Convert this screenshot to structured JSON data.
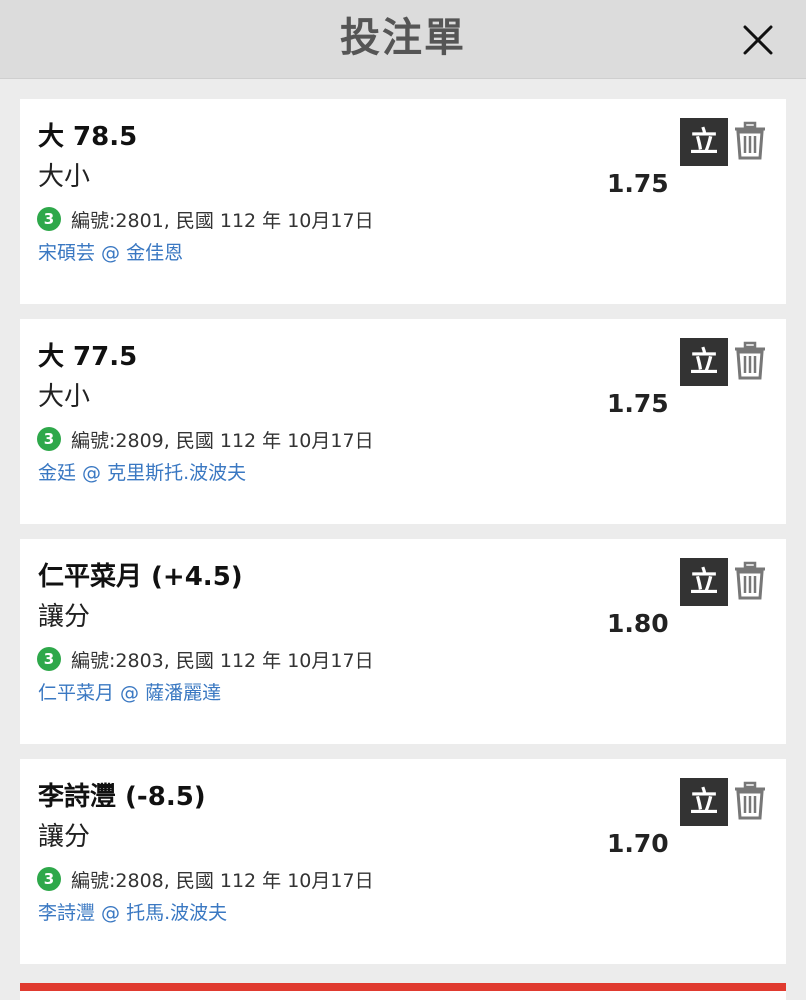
{
  "header": {
    "title": "投注單"
  },
  "bets": [
    {
      "selection": "大 78.5",
      "market": "大小",
      "odds": "1.75",
      "badge": "3",
      "meta": "編號:2801, 民國 112 年 10月17日",
      "teams": "宋碩芸 @ 金佳恩",
      "instant_label": "立"
    },
    {
      "selection": "大 77.5",
      "market": "大小",
      "odds": "1.75",
      "badge": "3",
      "meta": "編號:2809, 民國 112 年 10月17日",
      "teams": "金廷 @ 克里斯托.波波夫",
      "instant_label": "立"
    },
    {
      "selection": "仁平菜月 (+4.5)",
      "market": "讓分",
      "odds": "1.80",
      "badge": "3",
      "meta": "編號:2803, 民國 112 年 10月17日",
      "teams": "仁平菜月 @ 薩潘麗達",
      "instant_label": "立"
    },
    {
      "selection": "李詩灃 (-8.5)",
      "market": "讓分",
      "odds": "1.70",
      "badge": "3",
      "meta": "編號:2808, 民國 112 年 10月17日",
      "teams": "李詩灃 @ 托馬.波波夫",
      "instant_label": "立"
    }
  ],
  "colors": {
    "badge": "#2ea84a",
    "link": "#3a78c2",
    "accent_bar": "#e03a2f",
    "instant_button": "#333333"
  },
  "icons": {
    "close": "close-icon",
    "trash": "trash-icon"
  }
}
